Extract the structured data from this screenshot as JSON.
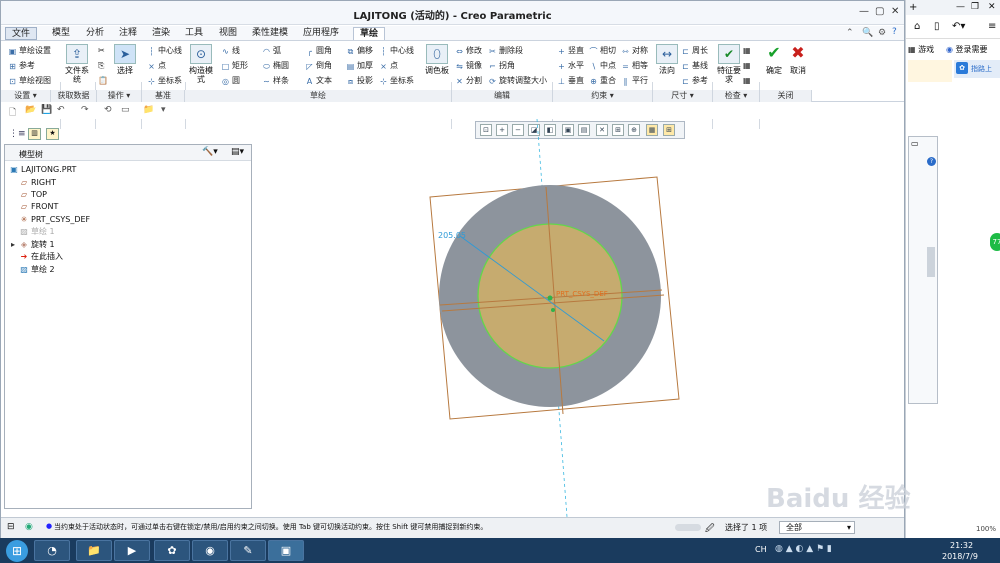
{
  "app": {
    "title": "LAJITONG (活动的) - Creo Parametric"
  },
  "tabs": [
    "文件",
    "模型",
    "分析",
    "注释",
    "渲染",
    "工具",
    "视图",
    "柔性建模",
    "应用程序",
    "草绘"
  ],
  "ribbon": {
    "setup": {
      "sketch_setup": "草绘设置",
      "reference": "参考",
      "sketch_view": "草绘视图"
    },
    "get_data": {
      "file_system": "文件系统"
    },
    "operations": {
      "select": "选择"
    },
    "datum": {
      "centerline": "中心线",
      "point": "点",
      "csys": "坐标系"
    },
    "sketch": {
      "construction_mode": "构造模式",
      "line": "线",
      "rectangle": "矩形",
      "circle": "圆",
      "arc": "弧",
      "ellipse": "椭圆",
      "spline": "样条",
      "fillet": "圆角",
      "chamfer": "倒角",
      "text": "文本",
      "offset": "偏移",
      "thicken": "加厚",
      "project": "投影",
      "centerline": "中心线",
      "point": "点",
      "csys": "坐标系",
      "palette": "调色板"
    },
    "edit": {
      "modify": "修改",
      "mirror": "镜像",
      "divide": "分割",
      "delete_segment": "删除段",
      "corner": "拐角",
      "rotate_resize": "旋转调整大小"
    },
    "constrain": {
      "vertical": "竖直",
      "horizontal": "水平",
      "perpendicular": "垂直",
      "tangent": "相切",
      "midpoint": "中点",
      "coincident": "重合",
      "symmetric": "对称",
      "equal": "相等",
      "parallel": "平行"
    },
    "dimension": {
      "normal": "法向",
      "perimeter": "周长",
      "baseline": "基线",
      "reference": "参考"
    },
    "inspect": {
      "feature_requirements": "特征要求"
    },
    "close": {
      "ok": "确定",
      "cancel": "取消"
    },
    "groups": [
      "设置",
      "获取数据",
      "操作",
      "基准",
      "草绘",
      "编辑",
      "约束",
      "尺寸",
      "检查",
      "关闭"
    ]
  },
  "tree": {
    "title": "模型树",
    "items": [
      "LAJITONG.PRT",
      "RIGHT",
      "TOP",
      "FRONT",
      "PRT_CSYS_DEF",
      "草绘 1",
      "旋转 1",
      "在此插入",
      "草绘 2"
    ]
  },
  "graphics": {
    "dimension": "205.05",
    "csys_label": "PRT_CSYS_DEF"
  },
  "status": {
    "message": "当约束处于活动状态时，可通过单击右键在锁定/禁用/启用约束之间切换。使用 Tab 键可切换活动约束。按住 Shift 键可禁用捕捉到新约束。",
    "selection": "选择了 1 项",
    "filter": "全部"
  },
  "right_panel": {
    "games": "游戏",
    "login": "登录需要",
    "pointer": "指路上"
  },
  "taskbar": {
    "time": "21:32",
    "date": "2018/7/9",
    "watermark": "Baidu 经验"
  },
  "zoom": "100%"
}
